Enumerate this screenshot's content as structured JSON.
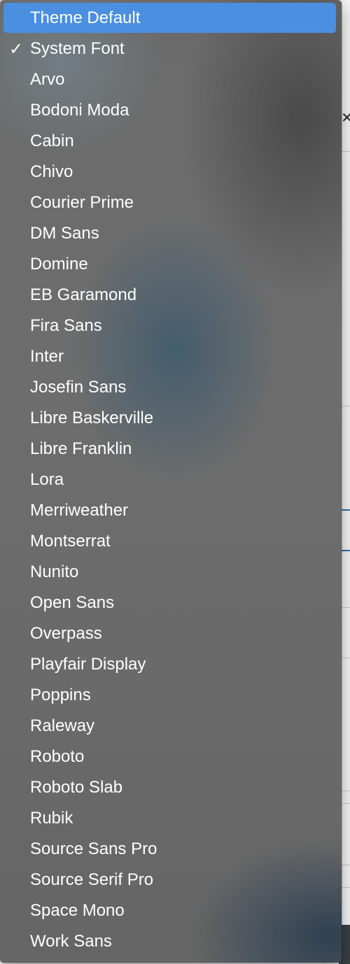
{
  "menu": {
    "selected_item": "System Font",
    "highlighted_item": "Theme Default",
    "items": [
      {
        "label": "Theme Default",
        "checked": false,
        "highlighted": true
      },
      {
        "label": "System Font",
        "checked": true,
        "highlighted": false
      },
      {
        "label": "Arvo",
        "checked": false,
        "highlighted": false
      },
      {
        "label": "Bodoni Moda",
        "checked": false,
        "highlighted": false
      },
      {
        "label": "Cabin",
        "checked": false,
        "highlighted": false
      },
      {
        "label": "Chivo",
        "checked": false,
        "highlighted": false
      },
      {
        "label": "Courier Prime",
        "checked": false,
        "highlighted": false
      },
      {
        "label": "DM Sans",
        "checked": false,
        "highlighted": false
      },
      {
        "label": "Domine",
        "checked": false,
        "highlighted": false
      },
      {
        "label": "EB Garamond",
        "checked": false,
        "highlighted": false
      },
      {
        "label": "Fira Sans",
        "checked": false,
        "highlighted": false
      },
      {
        "label": "Inter",
        "checked": false,
        "highlighted": false
      },
      {
        "label": "Josefin Sans",
        "checked": false,
        "highlighted": false
      },
      {
        "label": "Libre Baskerville",
        "checked": false,
        "highlighted": false
      },
      {
        "label": "Libre Franklin",
        "checked": false,
        "highlighted": false
      },
      {
        "label": "Lora",
        "checked": false,
        "highlighted": false
      },
      {
        "label": "Merriweather",
        "checked": false,
        "highlighted": false
      },
      {
        "label": "Montserrat",
        "checked": false,
        "highlighted": false
      },
      {
        "label": "Nunito",
        "checked": false,
        "highlighted": false
      },
      {
        "label": "Open Sans",
        "checked": false,
        "highlighted": false
      },
      {
        "label": "Overpass",
        "checked": false,
        "highlighted": false
      },
      {
        "label": "Playfair Display",
        "checked": false,
        "highlighted": false
      },
      {
        "label": "Poppins",
        "checked": false,
        "highlighted": false
      },
      {
        "label": "Raleway",
        "checked": false,
        "highlighted": false
      },
      {
        "label": "Roboto",
        "checked": false,
        "highlighted": false
      },
      {
        "label": "Roboto Slab",
        "checked": false,
        "highlighted": false
      },
      {
        "label": "Rubik",
        "checked": false,
        "highlighted": false
      },
      {
        "label": "Source Sans Pro",
        "checked": false,
        "highlighted": false
      },
      {
        "label": "Source Serif Pro",
        "checked": false,
        "highlighted": false
      },
      {
        "label": "Space Mono",
        "checked": false,
        "highlighted": false
      },
      {
        "label": "Work Sans",
        "checked": false,
        "highlighted": false
      }
    ]
  },
  "icons": {
    "checkmark": "checkmark-icon",
    "close": "close-icon"
  },
  "colors": {
    "highlight": "#4a8fe0",
    "menu_text": "#ffffff",
    "menu_background": "#6b6b6b"
  }
}
